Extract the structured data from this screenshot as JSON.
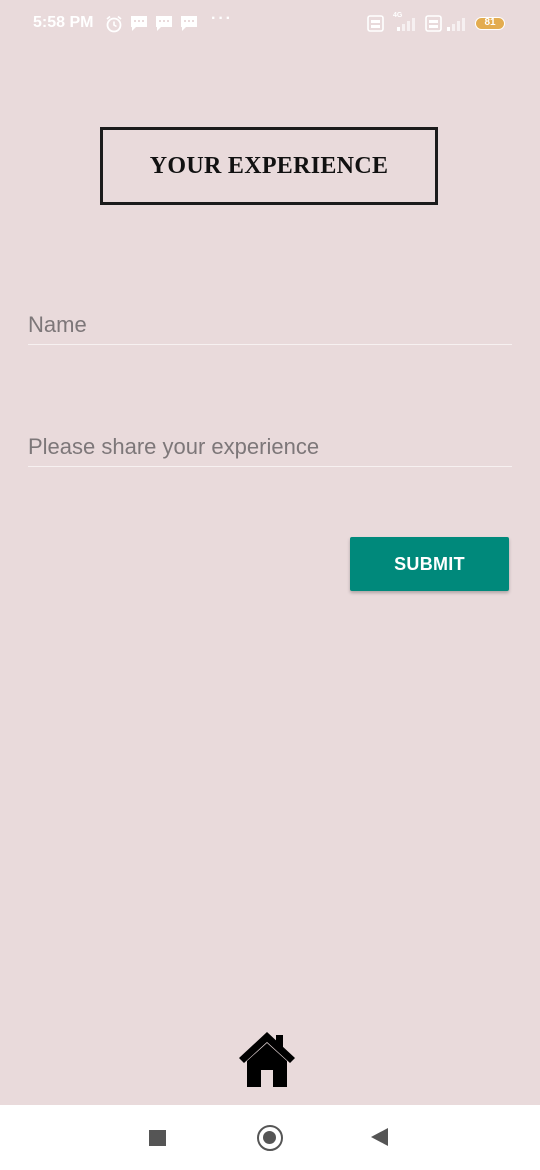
{
  "status_bar": {
    "time": "5:58 PM",
    "battery_level": "81",
    "network_label": "4G",
    "icons": [
      "alarm-icon",
      "message-icon",
      "message-icon",
      "message-icon",
      "more-dots-icon",
      "volte-icon",
      "signal-icon",
      "volte-icon",
      "signal-icon",
      "battery-icon"
    ],
    "battery_color": "#e3ac4f"
  },
  "header": {
    "title": "YOUR EXPERIENCE"
  },
  "form": {
    "name_placeholder": "Name",
    "name_value": "",
    "experience_placeholder": "Please share your experience",
    "experience_value": "",
    "submit_label": "SUBMIT"
  },
  "footer": {
    "home_icon": "home-icon"
  },
  "nav": {
    "icons": [
      "recent-apps-icon",
      "home-nav-icon",
      "back-icon"
    ]
  },
  "colors": {
    "background": "#e9dadb",
    "accent": "#00897b",
    "title_border": "#1b1b1b"
  }
}
